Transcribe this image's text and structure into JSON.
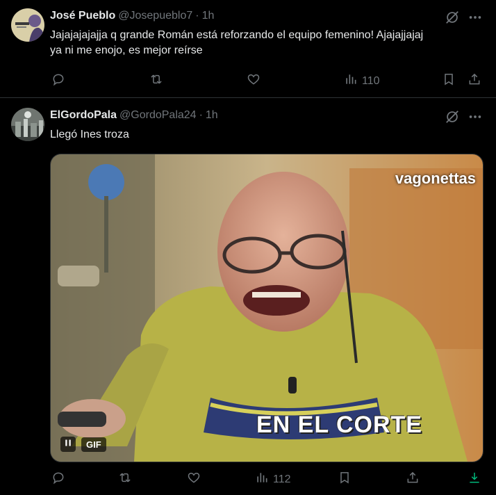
{
  "tweets": [
    {
      "name": "José Pueblo",
      "handle": "@Josepueblo7",
      "separator": "·",
      "time": "1h",
      "text_line1": "Jajajajajajja q grande Román está reforzando el equipo femenino! Ajajajjajaj",
      "text_line2": "ya ni me enojo, es mejor reírse",
      "views": "110"
    },
    {
      "name": "ElGordoPala",
      "handle": "@GordoPala24",
      "separator": "·",
      "time": "1h",
      "text_line1": "Llegó Ines troza",
      "views": "112",
      "media": {
        "watermark": "vagonettas",
        "caption": "EN EL CORTE",
        "gif_label": "GIF"
      }
    }
  ],
  "colors": {
    "background": "#000000",
    "text": "#e7e9ea",
    "muted": "#71767b",
    "border": "#2f3336",
    "download_accent": "#00ba7c"
  },
  "icons": [
    "grok-icon",
    "more-icon",
    "reply-icon",
    "retweet-icon",
    "like-icon",
    "views-icon",
    "bookmark-icon",
    "share-icon",
    "download-icon",
    "pause-icon"
  ]
}
